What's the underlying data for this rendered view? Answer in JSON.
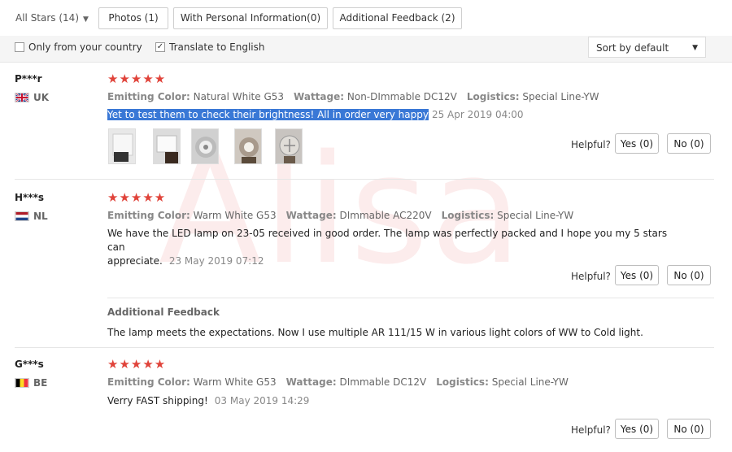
{
  "watermark": "Alisa",
  "filters": {
    "all_stars": "All Stars (14)",
    "tabs": [
      "Photos (1)",
      "With Personal Information(0)",
      "Additional Feedback (2)"
    ]
  },
  "options": {
    "only_country": "Only from your country",
    "translate": "Translate to English",
    "translate_checked": "✓",
    "sort": "Sort by default"
  },
  "reviews": [
    {
      "user": "P***r",
      "country": "UK",
      "stars": "★★★★★",
      "emit_label": "Emitting Color:",
      "emit_value": "Natural White G53",
      "watt_label": "Wattage:",
      "watt_value": "Non-DImmable DC12V",
      "log_label": "Logistics:",
      "log_value": "Special Line-YW",
      "text": "Yet to test them to check their brightness! All in order very happy",
      "date": "25 Apr 2019 04:00",
      "helpful": "Helpful?",
      "yes": "Yes (0)",
      "no": "No (0)"
    },
    {
      "user": "H***s",
      "country": "NL",
      "stars": "★★★★★",
      "emit_label": "Emitting Color:",
      "emit_value": "Warm White G53",
      "watt_label": "Wattage:",
      "watt_value": "DImmable AC220V",
      "log_label": "Logistics:",
      "log_value": "Special Line-YW",
      "text_line1": "We have the LED lamp on 23-05 received in good order. The lamp was perfectly packed and I hope you my 5 stars can",
      "text_line2": "appreciate.",
      "date": "23 May 2019 07:12",
      "helpful": "Helpful?",
      "yes": "Yes (0)",
      "no": "No (0)",
      "additional_label": "Additional Feedback",
      "additional_text": "The lamp meets the expectations. Now I use multiple AR 111/15 W in various light colors of WW to Cold light."
    },
    {
      "user": "G***s",
      "country": "BE",
      "stars": "★★★★★",
      "emit_label": "Emitting Color:",
      "emit_value": "Warm White G53",
      "watt_label": "Wattage:",
      "watt_value": "DImmable DC12V",
      "log_label": "Logistics:",
      "log_value": "Special Line-YW",
      "text": "Verry FAST shipping!",
      "date": "03 May 2019 14:29",
      "helpful": "Helpful?",
      "yes": "Yes (0)",
      "no": "No (0)"
    }
  ],
  "colors": {
    "star": "#e0433a",
    "highlight": "#3978d6"
  }
}
